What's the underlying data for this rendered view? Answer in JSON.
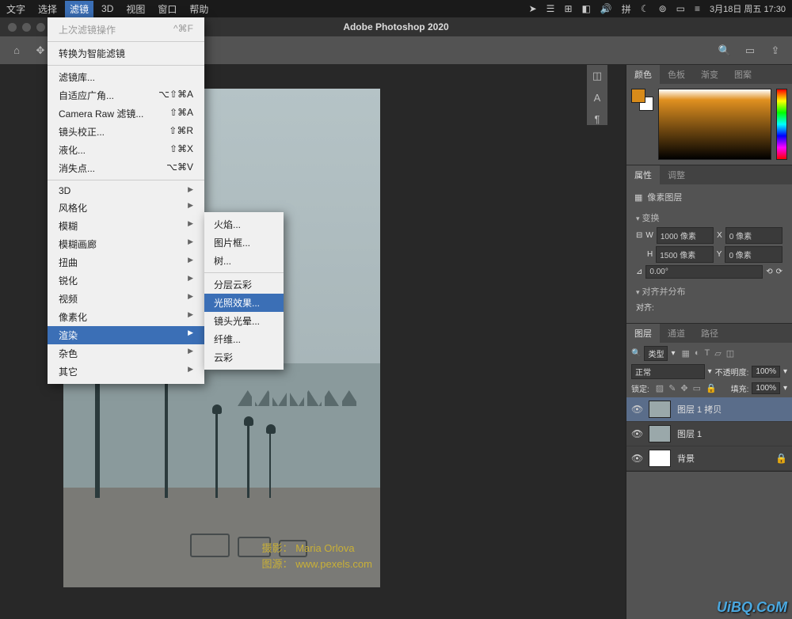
{
  "menubar": {
    "items": [
      "文字",
      "选择",
      "滤镜",
      "3D",
      "视图",
      "窗口",
      "帮助"
    ],
    "active_index": 2,
    "datetime": "3月18日 周五  17:30",
    "input_method": "拼"
  },
  "titlebar": {
    "title": "Adobe Photoshop 2020"
  },
  "filter_menu": {
    "last_filter": {
      "label": "上次滤镜操作",
      "shortcut": "^⌘F"
    },
    "convert_smart": "转换为智能滤镜",
    "filter_gallery": "滤镜库...",
    "adaptive_wide": {
      "label": "自适应广角...",
      "shortcut": "⌥⇧⌘A"
    },
    "camera_raw": {
      "label": "Camera Raw 滤镜...",
      "shortcut": "⇧⌘A"
    },
    "lens_correction": {
      "label": "镜头校正...",
      "shortcut": "⇧⌘R"
    },
    "liquify": {
      "label": "液化...",
      "shortcut": "⇧⌘X"
    },
    "vanishing": {
      "label": "消失点...",
      "shortcut": "⌥⌘V"
    },
    "groups": [
      "3D",
      "风格化",
      "模糊",
      "模糊画廊",
      "扭曲",
      "锐化",
      "视频",
      "像素化",
      "渲染",
      "杂色",
      "其它"
    ]
  },
  "render_submenu": {
    "items": [
      "火焰...",
      "图片框...",
      "树..."
    ],
    "items2": [
      "分层云彩",
      "光照效果...",
      "镜头光晕...",
      "纤维...",
      "云彩"
    ],
    "highlight_index": 1
  },
  "color_panel": {
    "tabs": [
      "颜色",
      "色板",
      "渐变",
      "图案"
    ]
  },
  "properties_panel": {
    "tabs": [
      "属性",
      "调整"
    ],
    "layer_type": "像素图层",
    "transform_label": "变换",
    "w": "1000 像素",
    "x": "0 像素",
    "h": "1500 像素",
    "y": "0 像素",
    "angle": "0.00°",
    "align_label": "对齐并分布",
    "align_note": "对齐:"
  },
  "layers_panel": {
    "tabs": [
      "图层",
      "通道",
      "路径"
    ],
    "filter_type": "类型",
    "blend_mode": "正常",
    "opacity_label": "不透明度:",
    "opacity": "100%",
    "lock_label": "锁定:",
    "fill_label": "填充:",
    "fill": "100%",
    "layers": [
      {
        "name": "图层 1 拷贝",
        "active": true
      },
      {
        "name": "图层 1",
        "active": false
      },
      {
        "name": "背景",
        "active": false,
        "white": true
      }
    ]
  },
  "credit": {
    "photo_label": "摄影：",
    "photographer": "Maria Orlova",
    "source_label": "图源：",
    "source": "www.pexels.com"
  },
  "watermark": "UiBQ.CoM"
}
